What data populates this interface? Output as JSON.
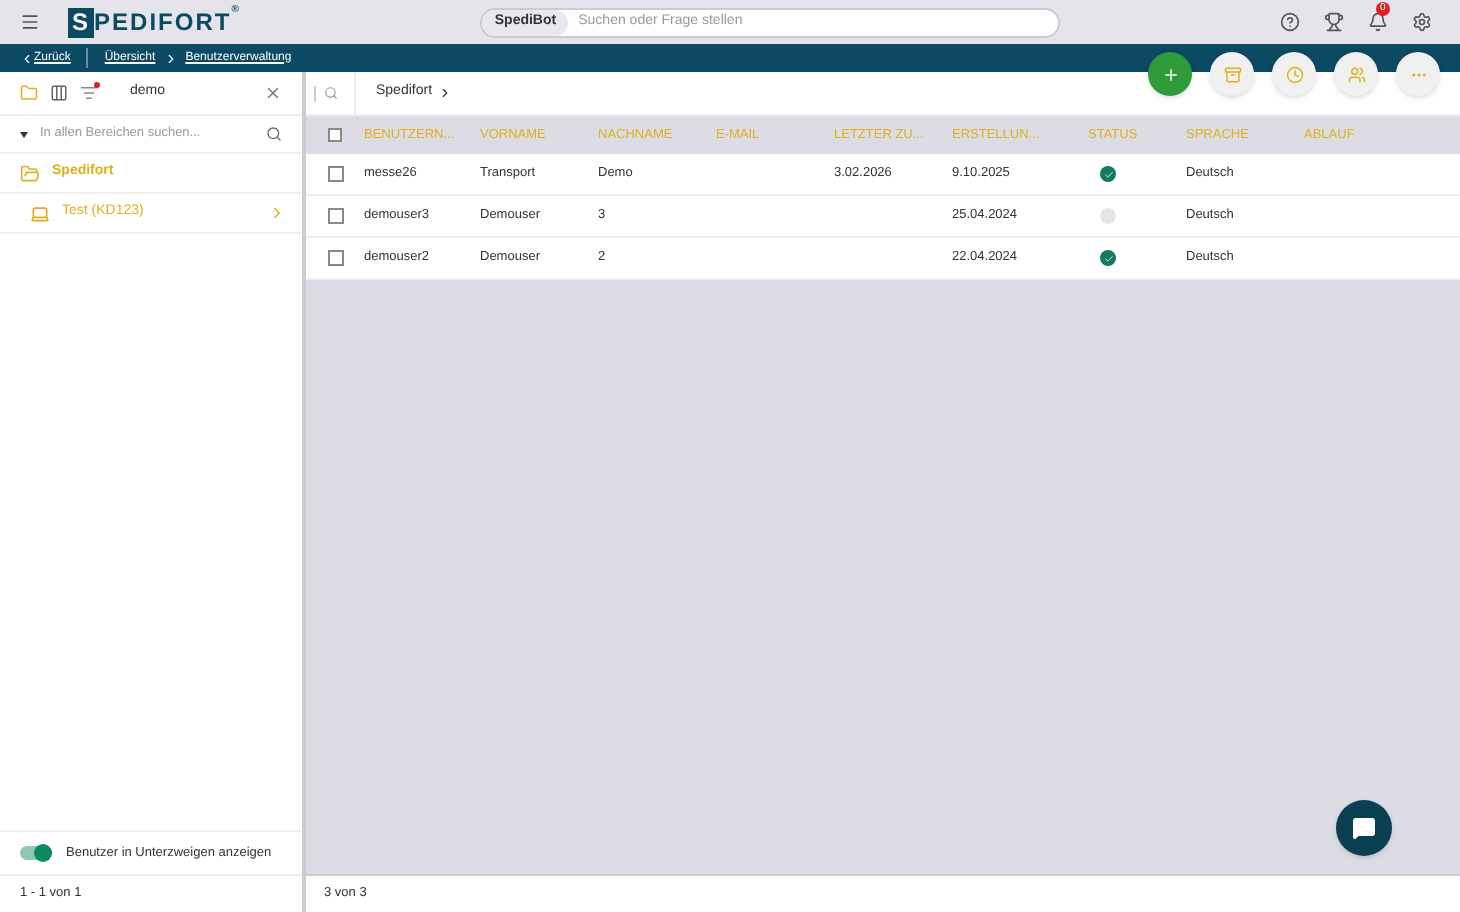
{
  "logo": {
    "initial": "S",
    "rest": "PEDIFORT",
    "mark": "®"
  },
  "search": {
    "bot_label": "SpediBot",
    "placeholder": "Suchen oder Frage stellen"
  },
  "notifications": {
    "count": "0"
  },
  "breadcrumb": {
    "back": "Zurück",
    "items": [
      "Übersicht",
      "Benutzerverwaltung"
    ]
  },
  "filter": {
    "value": "demo",
    "active": true
  },
  "path": "Spedifort",
  "actions": [
    {
      "kind": "add"
    },
    {
      "kind": "archive"
    },
    {
      "kind": "clock"
    },
    {
      "kind": "users"
    },
    {
      "kind": "more"
    }
  ],
  "sidebar": {
    "search_placeholder": "In allen Bereichen suchen...",
    "tree": [
      {
        "label": "Spedifort",
        "kind": "folder",
        "selected": true,
        "children": [
          {
            "label": "Test (KD123)",
            "kind": "laptop",
            "selected": false
          }
        ]
      }
    ],
    "toggle": {
      "label": "Benutzer in Unterzweigen anzeigen",
      "on": true
    },
    "footer": "1 - 1 von 1"
  },
  "table": {
    "all_checked": false,
    "columns": [
      "BENUTZERN...",
      "VORNAME",
      "NACHNAME",
      "E-MAIL",
      "LETZTER ZU...",
      "ERSTELLUN...",
      "STATUS",
      "SPRACHE",
      "ABLAUF"
    ],
    "rows": [
      {
        "checked": false,
        "cells": [
          "messe26",
          "Transport",
          "Demo",
          "",
          "3.02.2026",
          "9.10.2025"
        ],
        "active": true,
        "language": "Deutsch"
      },
      {
        "checked": false,
        "cells": [
          "demouser3",
          "Demouser",
          "3",
          "",
          "",
          "25.04.2024"
        ],
        "active": false,
        "language": "Deutsch"
      },
      {
        "checked": false,
        "cells": [
          "demouser2",
          "Demouser",
          "2",
          "",
          "",
          "22.04.2024"
        ],
        "active": true,
        "language": "Deutsch"
      }
    ],
    "footer": "3 von 3"
  }
}
